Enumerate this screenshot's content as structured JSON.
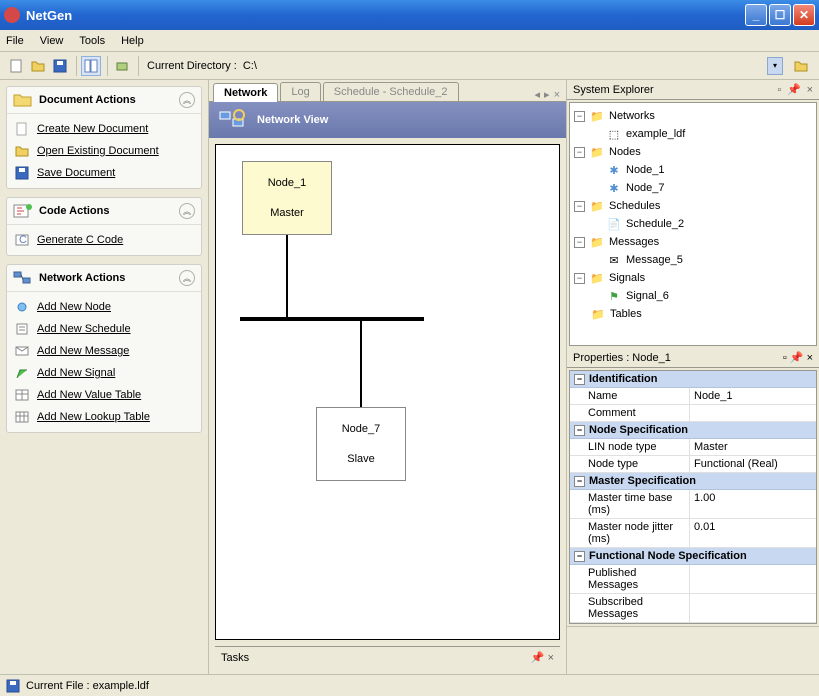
{
  "window": {
    "title": "NetGen"
  },
  "menu": {
    "file": "File",
    "view": "View",
    "tools": "Tools",
    "help": "Help"
  },
  "toolbar": {
    "cd_label": "Current Directory :",
    "cd_value": "C:\\"
  },
  "left": {
    "doc": {
      "title": "Document Actions",
      "create": "Create New Document",
      "open": "Open Existing Document",
      "save": "Save Document"
    },
    "code": {
      "title": "Code Actions",
      "gen": "Generate C Code"
    },
    "net": {
      "title": "Network Actions",
      "add_node": "Add New Node",
      "add_schedule": "Add New Schedule",
      "add_message": "Add New Message",
      "add_signal": "Add New Signal",
      "add_value_table": "Add New Value Table",
      "add_lookup_table": "Add New Lookup Table"
    }
  },
  "tabs": {
    "network": "Network",
    "log": "Log",
    "schedule": "Schedule - Schedule_2"
  },
  "network_view": {
    "title": "Network View",
    "node1_name": "Node_1",
    "node1_role": "Master",
    "node7_name": "Node_7",
    "node7_role": "Slave"
  },
  "tasks": {
    "title": "Tasks"
  },
  "explorer": {
    "title": "System Explorer",
    "networks": "Networks",
    "example_ldf": "example_ldf",
    "nodes": "Nodes",
    "node1": "Node_1",
    "node7": "Node_7",
    "schedules": "Schedules",
    "schedule2": "Schedule_2",
    "messages": "Messages",
    "message5": "Message_5",
    "signals": "Signals",
    "signal6": "Signal_6",
    "tables": "Tables"
  },
  "properties": {
    "title": "Properties : Node_1",
    "cat_identification": "Identification",
    "name_label": "Name",
    "name_value": "Node_1",
    "comment_label": "Comment",
    "comment_value": "",
    "cat_node_spec": "Node Specification",
    "lin_type_label": "LIN node type",
    "lin_type_value": "Master",
    "node_type_label": "Node type",
    "node_type_value": "Functional (Real)",
    "cat_master_spec": "Master Specification",
    "time_base_label": "Master time base (ms)",
    "time_base_value": "1.00",
    "jitter_label": "Master node jitter (ms)",
    "jitter_value": "0.01",
    "cat_func_spec": "Functional Node Specification",
    "pub_label": "Published Messages",
    "pub_value": "",
    "sub_label": "Subscribed Messages",
    "sub_value": ""
  },
  "status": {
    "current_file": "Current File : example.ldf"
  }
}
